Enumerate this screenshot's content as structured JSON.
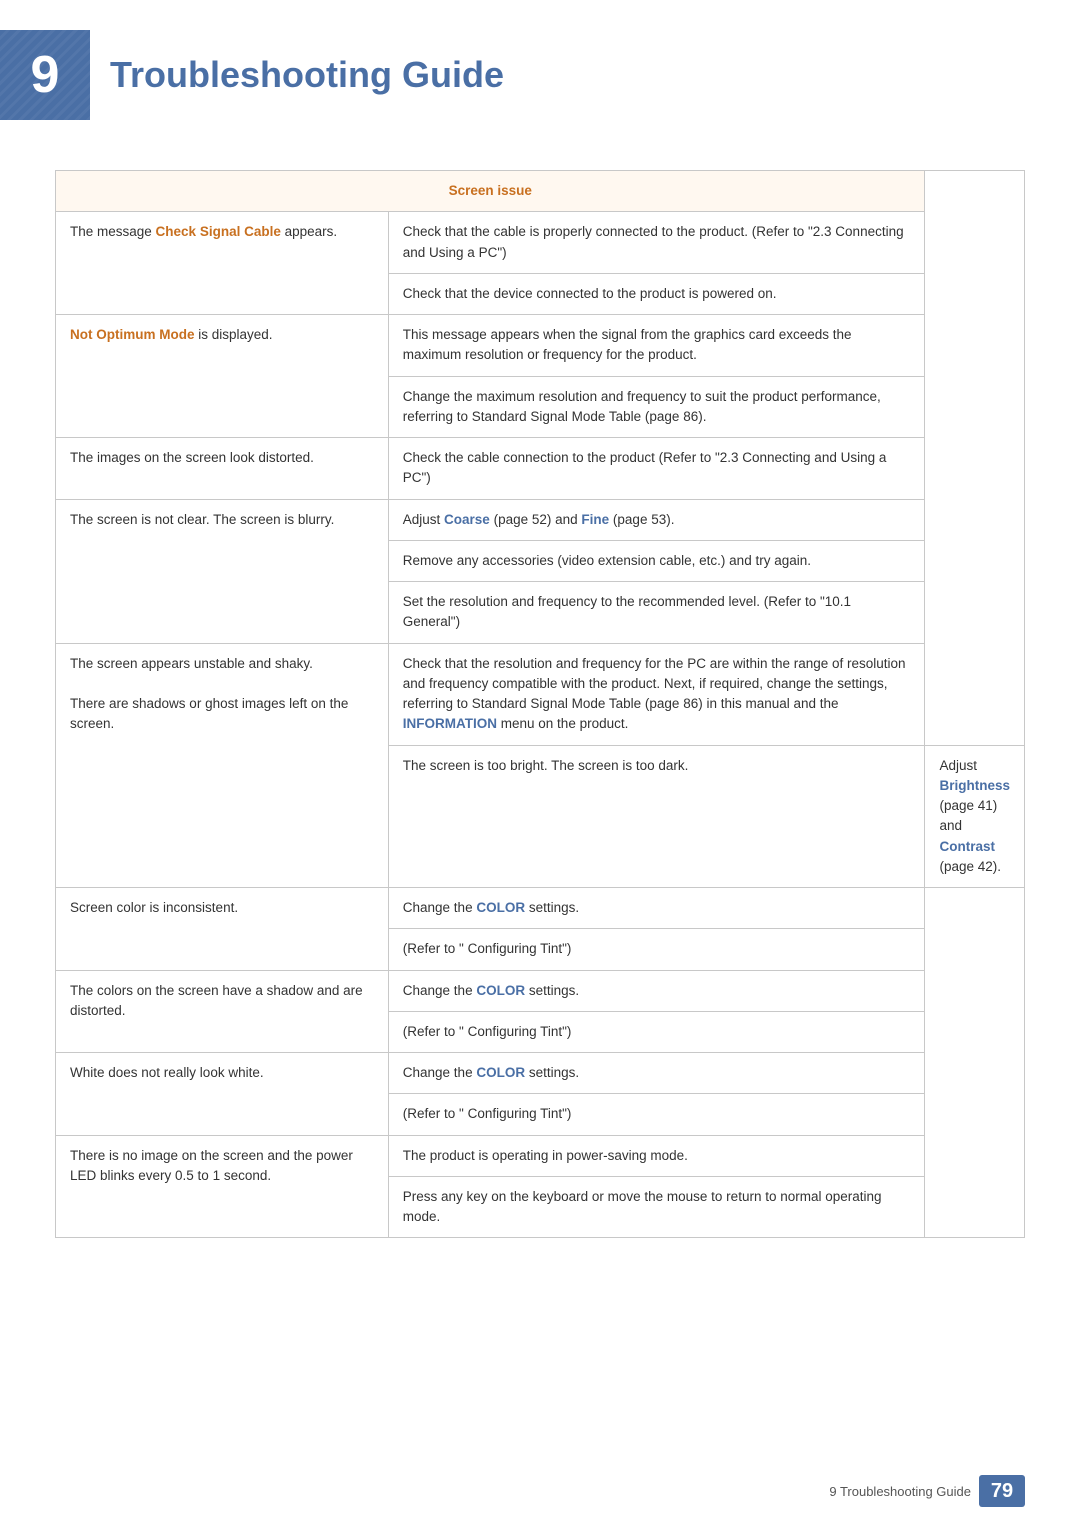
{
  "header": {
    "chapter_number": "9",
    "title": "Troubleshooting Guide"
  },
  "table": {
    "section_header": "Screen issue",
    "rows": [
      {
        "issue": "The message <bold-orange>Check Signal Cable</bold-orange> appears.",
        "issue_plain": "The message ",
        "issue_bold": "Check Signal Cable",
        "issue_bold_type": "orange",
        "issue_suffix": " appears.",
        "solutions": [
          "Check that the cable is properly connected to the product. (Refer to \"2.3 Connecting and Using a PC\")",
          "Check that the device connected to the product is powered on."
        ]
      },
      {
        "issue_bold": "Not Optimum Mode",
        "issue_bold_type": "orange",
        "issue_suffix": " is displayed.",
        "solutions": [
          "This message appears when the signal from the graphics card exceeds the maximum resolution or frequency for the product.",
          "Change the maximum resolution and frequency to suit the product performance, referring to Standard Signal Mode Table (page 86)."
        ]
      },
      {
        "issue_plain": "The images on the screen look distorted.",
        "solutions": [
          "Check the cable connection to the product (Refer to \"2.3 Connecting and Using a PC\")"
        ]
      },
      {
        "issue_plain": "The screen is not clear. The screen is blurry.",
        "solutions": [
          "Adjust <bold-blue>Coarse</bold-blue> (page 52) and <bold-blue>Fine</bold-blue> (page 53).",
          "Remove any accessories (video extension cable, etc.) and try again.",
          "Set the resolution and frequency to the recommended level. (Refer to \"10.1 General\")"
        ]
      },
      {
        "issue_plain": "The screen appears unstable and shaky.\nThere are shadows or ghost images left on the screen.",
        "solutions": [
          "Check that the resolution and frequency for the PC are within the range of resolution and frequency compatible with the product. Next, if required, change the settings, referring to Standard Signal Mode Table (page 86) in this manual and the <bold-blue>INFORMATION</bold-blue> menu on the product."
        ]
      },
      {
        "issue_plain": "The screen is too bright. The screen is too dark.",
        "solutions": [
          "Adjust <bold-blue>Brightness</bold-blue> (page 41) and <bold-blue>Contrast</bold-blue> (page 42)."
        ]
      },
      {
        "issue_plain": "Screen color is inconsistent.",
        "solutions": [
          "Change the <bold-blue>COLOR</bold-blue> settings.\n(Refer to \" Configuring Tint\")"
        ]
      },
      {
        "issue_plain": "The colors on the screen have a shadow and are distorted.",
        "solutions": [
          "Change the <bold-blue>COLOR</bold-blue> settings.\n(Refer to \" Configuring Tint\")"
        ]
      },
      {
        "issue_plain": "White does not really look white.",
        "solutions": [
          "Change the <bold-blue>COLOR</bold-blue> settings.\n(Refer to \" Configuring Tint\")"
        ]
      },
      {
        "issue_plain": "There is no image on the screen and the power LED blinks every 0.5 to 1 second.",
        "solutions": [
          "The product is operating in power-saving mode.",
          "Press any key on the keyboard or move the mouse to return to normal operating mode."
        ]
      }
    ]
  },
  "footer": {
    "text": "9 Troubleshooting Guide",
    "page": "79"
  }
}
